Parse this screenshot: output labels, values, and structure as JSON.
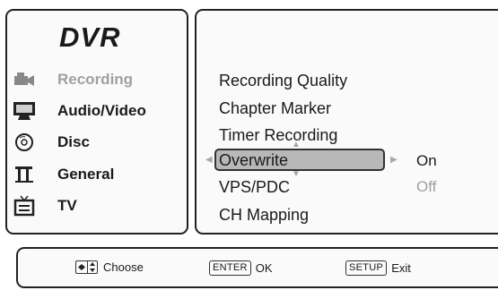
{
  "menu": {
    "title": "DVR",
    "categories": [
      {
        "icon": "camcorder-icon",
        "label": "Recording",
        "active": true
      },
      {
        "icon": "monitor-icon",
        "label": "Audio/Video"
      },
      {
        "icon": "disc-icon",
        "label": "Disc"
      },
      {
        "icon": "tools-icon",
        "label": "General"
      },
      {
        "icon": "tv-icon",
        "label": "TV"
      }
    ]
  },
  "settings": {
    "items": [
      "Recording Quality",
      "Chapter Marker",
      "Timer Recording",
      "Overwrite",
      "VPS/PDC",
      "CH Mapping"
    ],
    "selected": "Overwrite",
    "options": [
      "On",
      "Off"
    ],
    "current_option": "On"
  },
  "footer": {
    "choose_label": "Choose",
    "enter_key": "ENTER",
    "enter_label": "OK",
    "setup_key": "SETUP",
    "setup_label": "Exit"
  },
  "colors": {
    "highlight": "#b8b8b8",
    "dim_text": "#a0a0a0",
    "border": "#222222"
  }
}
